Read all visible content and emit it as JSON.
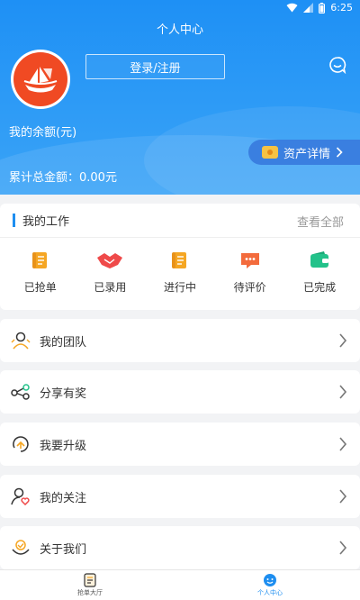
{
  "statusbar": {
    "time": "6:25"
  },
  "header": {
    "title": "个人中心",
    "login_label": "登录/注册",
    "balance_label": "我的余额(元)",
    "asset_details": "资产详情",
    "total_gold": "累计总金额：0.00元"
  },
  "work": {
    "title": "我的工作",
    "view_all": "查看全部",
    "items": [
      {
        "label": "已抢单",
        "icon": "scroll-icon",
        "color": "#f5a623"
      },
      {
        "label": "已录用",
        "icon": "handshake-icon",
        "color": "#ef4a4a"
      },
      {
        "label": "进行中",
        "icon": "scroll-icon",
        "color": "#f5a623"
      },
      {
        "label": "待评价",
        "icon": "comment-icon",
        "color": "#f36b3c"
      },
      {
        "label": "已完成",
        "icon": "wallet-icon",
        "color": "#23c28a"
      }
    ]
  },
  "menu": [
    {
      "label": "我的团队",
      "icon": "team-icon"
    },
    {
      "label": "分享有奖",
      "icon": "share-icon"
    },
    {
      "label": "我要升级",
      "icon": "upgrade-icon"
    },
    {
      "label": "我的关注",
      "icon": "follow-icon"
    },
    {
      "label": "关于我们",
      "icon": "about-icon"
    }
  ],
  "nav": [
    {
      "label": "抢单大厅",
      "icon": "order-hall-icon",
      "active": false
    },
    {
      "label": "个人中心",
      "icon": "personal-center-icon",
      "active": true
    }
  ],
  "colors": {
    "primary": "#1e8ef0",
    "accent_orange": "#f5a623"
  }
}
